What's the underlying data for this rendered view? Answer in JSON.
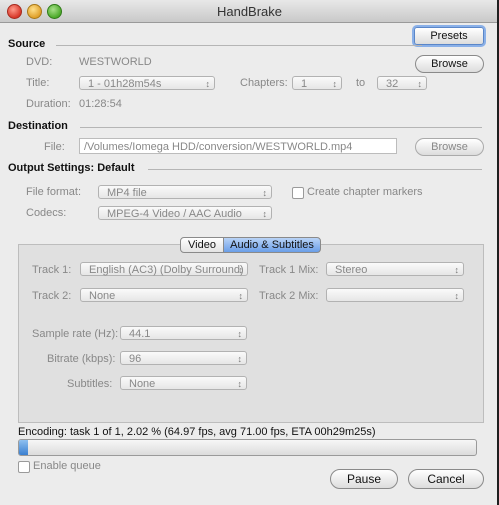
{
  "window": {
    "title": "HandBrake"
  },
  "toolbar": {
    "presets_label": "Presets"
  },
  "source": {
    "heading": "Source",
    "dvd_label": "DVD:",
    "dvd_value": "WESTWORLD",
    "browse_label": "Browse",
    "title_label": "Title:",
    "title_value": "1 - 01h28m54s",
    "chapters_label": "Chapters:",
    "chapter_from": "1",
    "to_label": "to",
    "chapter_to": "32",
    "duration_label": "Duration:",
    "duration_value": "01:28:54"
  },
  "destination": {
    "heading": "Destination",
    "file_label": "File:",
    "file_value": "/Volumes/Iomega HDD/conversion/WESTWORLD.mp4",
    "browse_label": "Browse"
  },
  "output": {
    "heading": "Output Settings: Default",
    "format_label": "File format:",
    "format_value": "MP4 file",
    "chapter_markers_label": "Create chapter markers",
    "codecs_label": "Codecs:",
    "codecs_value": "MPEG-4 Video / AAC Audio"
  },
  "tabs": {
    "video_label": "Video",
    "audio_label": "Audio & Subtitles",
    "selected": "Audio & Subtitles"
  },
  "audio": {
    "track1_label": "Track 1:",
    "track1_value": "English (AC3) (Dolby Surround)",
    "track1_mix_label": "Track 1 Mix:",
    "track1_mix_value": "Stereo",
    "track2_label": "Track 2:",
    "track2_value": "None",
    "track2_mix_label": "Track 2 Mix:",
    "track2_mix_value": "",
    "samplerate_label": "Sample rate (Hz):",
    "samplerate_value": "44.1",
    "bitrate_label": "Bitrate (kbps):",
    "bitrate_value": "96",
    "subtitles_label": "Subtitles:",
    "subtitles_value": "None"
  },
  "status": {
    "text": "Encoding: task 1 of 1, 2.02 % (64.97 fps, avg 71.00 fps, ETA 00h29m25s)",
    "progress_percent": 2.02,
    "enable_queue_label": "Enable queue"
  },
  "actions": {
    "pause_label": "Pause",
    "cancel_label": "Cancel"
  },
  "icons": {
    "popup_arrow": "updown-arrow-icon"
  }
}
